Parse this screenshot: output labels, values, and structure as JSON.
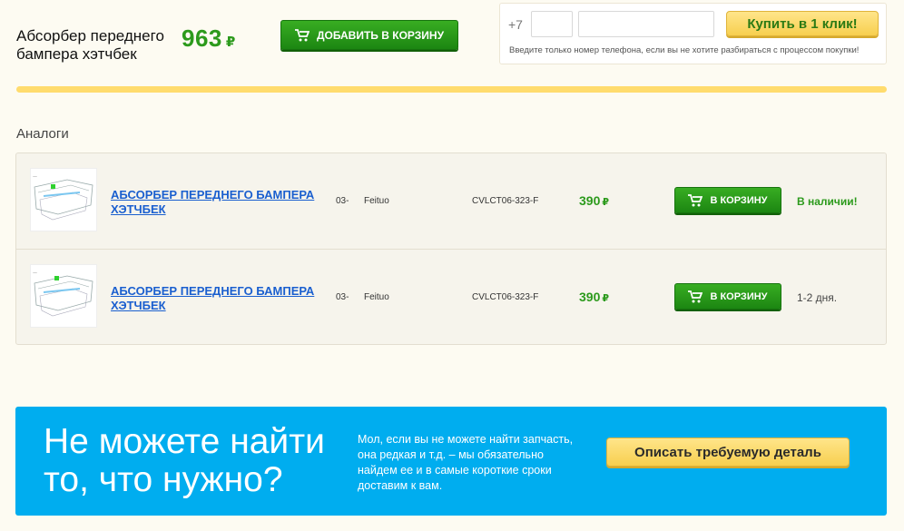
{
  "product": {
    "title": "Абсорбер переднего бампера хэтчбек",
    "price": "963",
    "currency": "₽",
    "add_to_cart_label": "Добавить в корзину"
  },
  "one_click": {
    "phone_prefix": "+7",
    "button_label": "Купить в 1 клик!",
    "hint": "Введите только номер телефона, если вы не хотите разбираться с процессом покупки!"
  },
  "analogs": {
    "title": "Аналоги",
    "rows": [
      {
        "name": "Абсорбер переднего бампера хэтчбек",
        "year": "03-",
        "brand": "Feituo",
        "code": "CVLCT06-323-F",
        "price": "390",
        "currency": "₽",
        "cart_label": "В корзину",
        "status": "В наличии!"
      },
      {
        "name": "Абсорбер переднего бампера хэтчбек",
        "year": "03-",
        "brand": "Feituo",
        "code": "CVLCT06-323-F",
        "price": "390",
        "currency": "₽",
        "cart_label": "В корзину",
        "status": "1-2 дня."
      }
    ]
  },
  "banner": {
    "heading": "Не можете найти то, что нужно?",
    "text": "Мол, если вы не можете найти запчасть, она редкая и т.д. – мы обязательно найдем ее и в самые короткие сроки доставим к вам.",
    "button_label": "Описать требуемую деталь"
  },
  "colors": {
    "green": "#2c9a1c",
    "link_blue": "#1a5fcf",
    "yellow": "#ffdc6e",
    "banner_blue": "#00adef"
  },
  "icons": [
    "cart-icon",
    "part-thumbnail"
  ]
}
